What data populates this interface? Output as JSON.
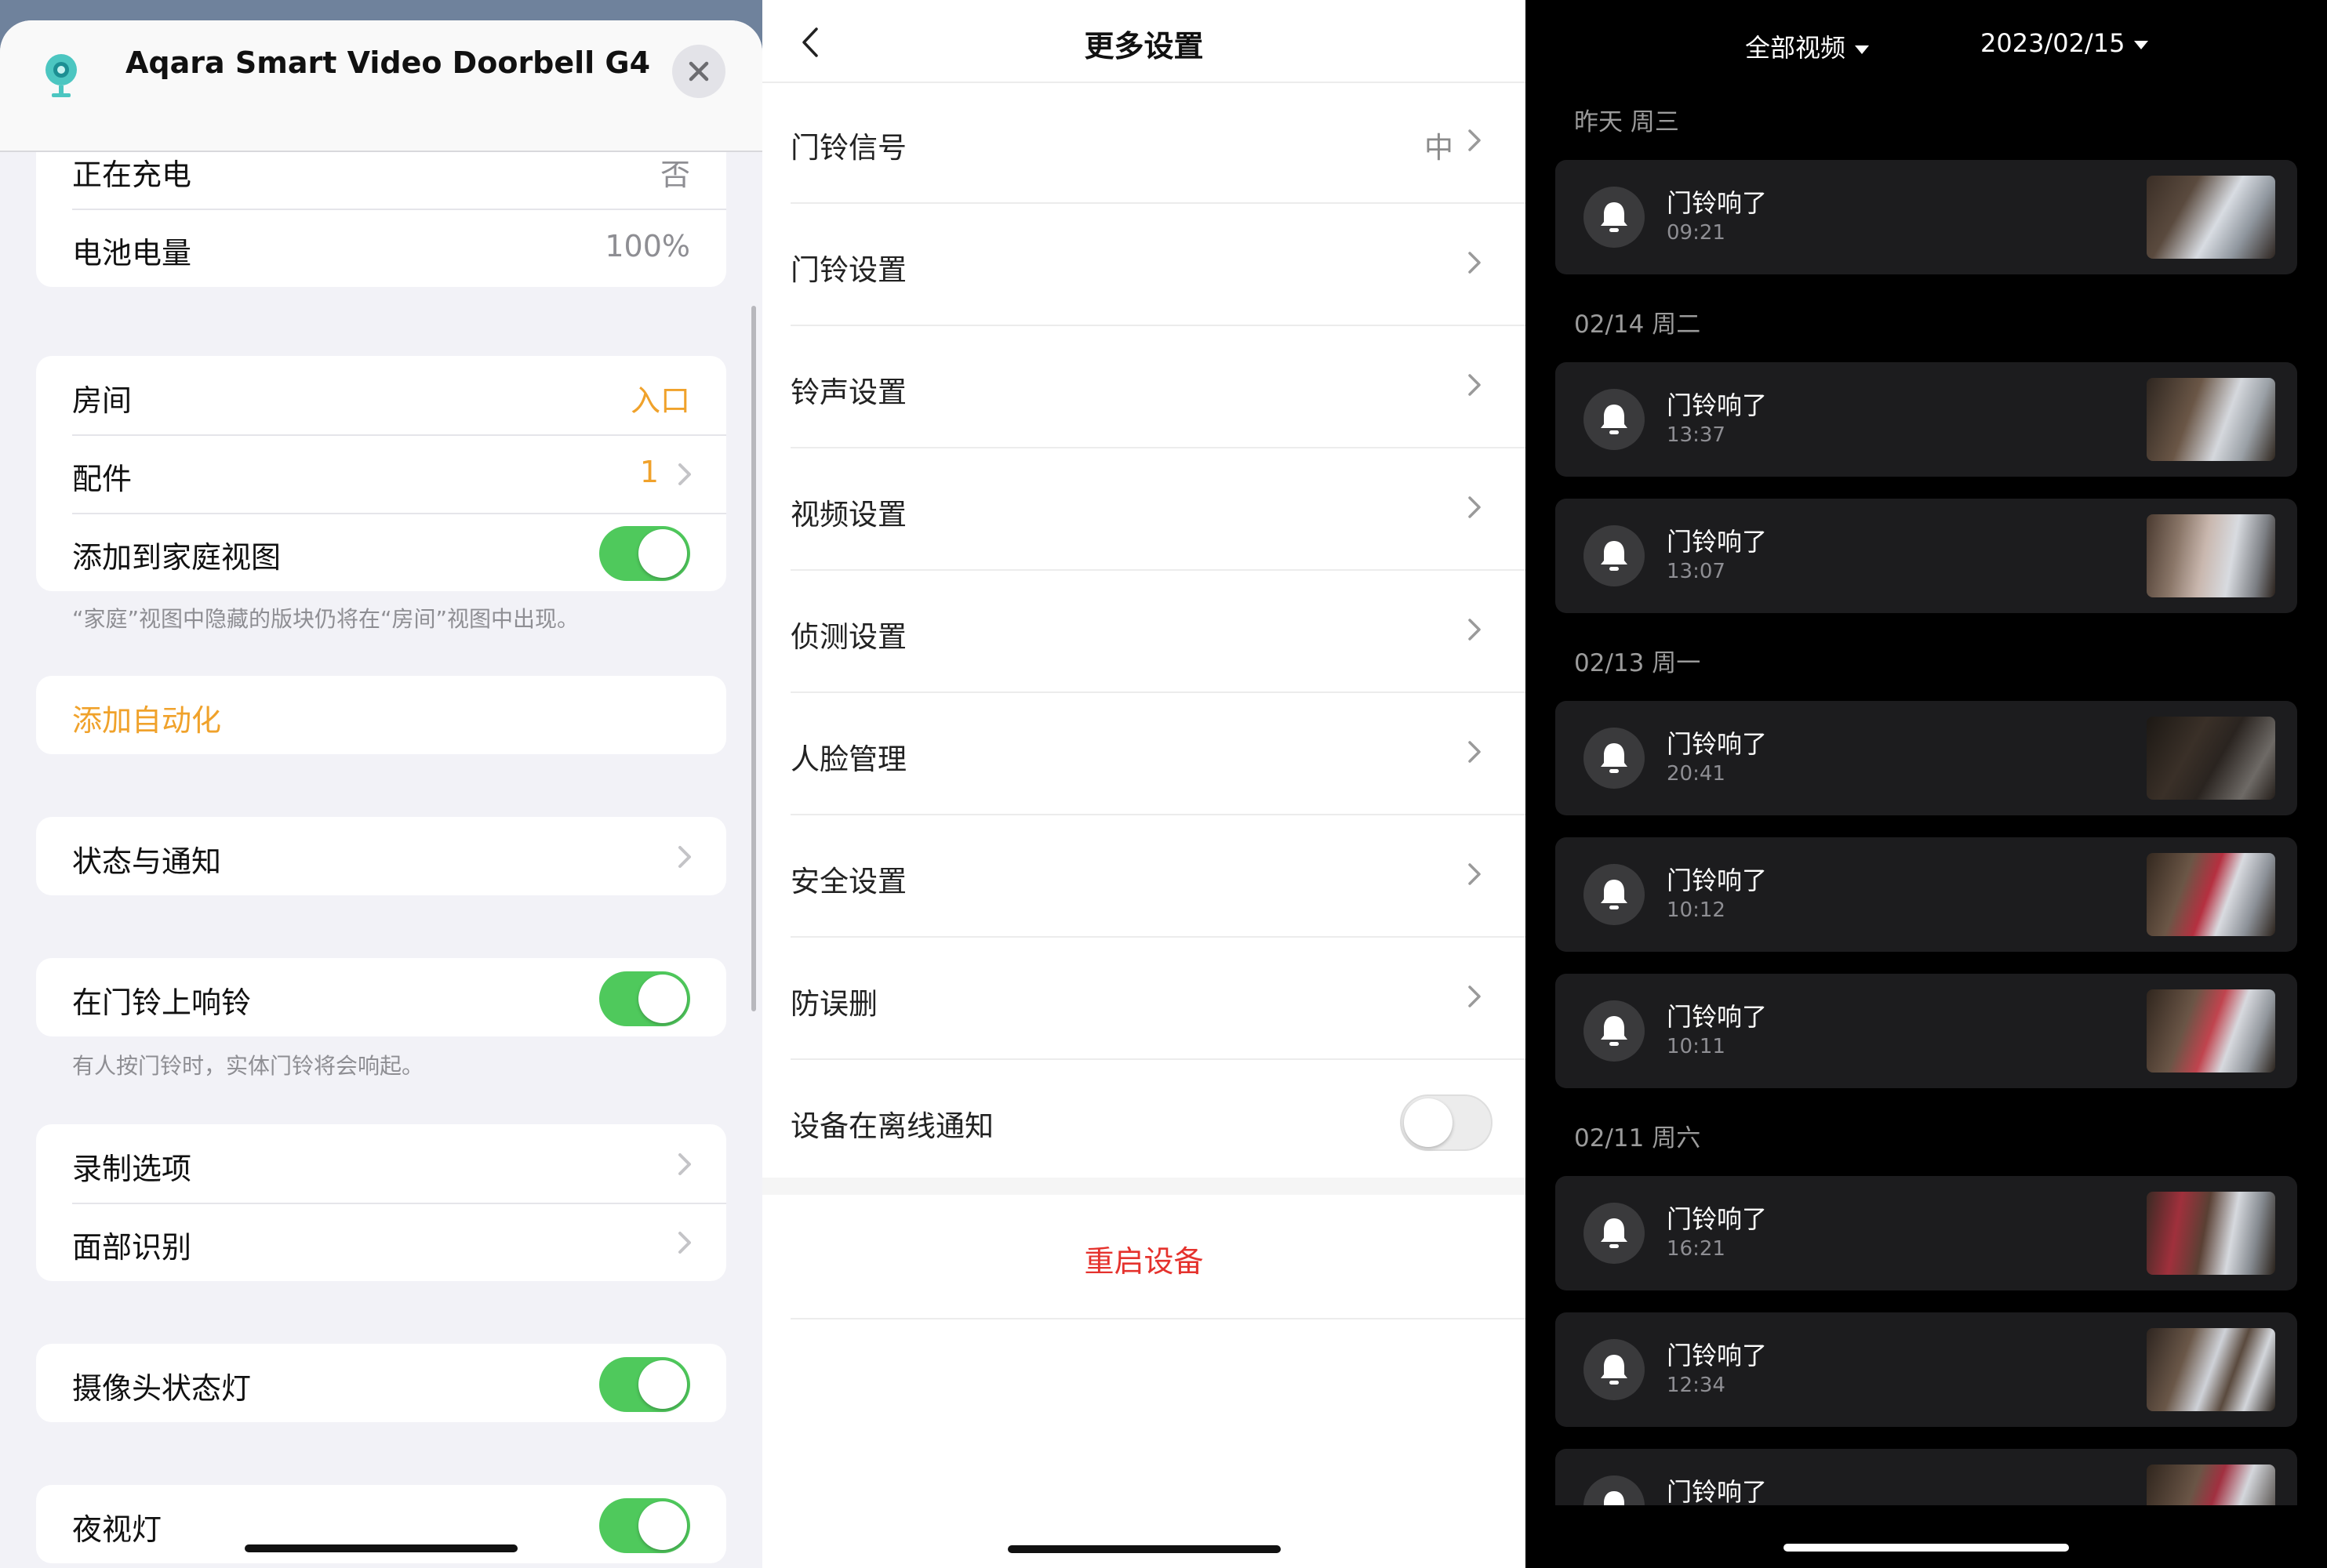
{
  "left": {
    "device_title": "Aqara Smart Video Doorbell G4",
    "rows_top": [
      {
        "label": "正在充电",
        "value": "否"
      },
      {
        "label": "电池电量",
        "value": "100%"
      }
    ],
    "room_group": {
      "room_label": "房间",
      "room_value": "入口",
      "accessory_label": "配件",
      "accessory_value": "1",
      "add_home_label": "添加到家庭视图",
      "add_home_on": true
    },
    "home_note": "“家庭”视图中隐藏的版块仍将在“房间”视图中出现。",
    "add_automation": "添加自动化",
    "status_notify": "状态与通知",
    "chime": {
      "label": "在门铃上响铃",
      "on": true
    },
    "chime_note": "有人按门铃时，实体门铃将会响起。",
    "recording": "录制选项",
    "face": "面部识别",
    "camera_light": {
      "label": "摄像头状态灯",
      "on": true
    },
    "night_light": {
      "label": "夜视灯",
      "on": true
    },
    "colors": {
      "accent": "#f0a22b",
      "toggle_on": "#4fc95c",
      "background": "#f2f2f7"
    }
  },
  "middle": {
    "title": "更多设置",
    "rows": [
      {
        "label": "门铃信号",
        "value": "中"
      },
      {
        "label": "门铃设置",
        "value": ""
      },
      {
        "label": "铃声设置",
        "value": ""
      },
      {
        "label": "视频设置",
        "value": ""
      },
      {
        "label": "侦测设置",
        "value": ""
      },
      {
        "label": "人脸管理",
        "value": ""
      },
      {
        "label": "安全设置",
        "value": ""
      },
      {
        "label": "防误删",
        "value": ""
      }
    ],
    "offline_label": "设备在离线通知",
    "offline_on": false,
    "restart": "重启设备",
    "colors": {
      "danger": "#e5322d"
    }
  },
  "right": {
    "filter_type": "全部视频",
    "filter_date": "2023/02/15",
    "groups": [
      {
        "day": "昨天 周三",
        "events": [
          {
            "title": "门铃响了",
            "time": "09:21"
          }
        ]
      },
      {
        "day": "02/14 周二",
        "events": [
          {
            "title": "门铃响了",
            "time": "13:37"
          },
          {
            "title": "门铃响了",
            "time": "13:07"
          }
        ]
      },
      {
        "day": "02/13 周一",
        "events": [
          {
            "title": "门铃响了",
            "time": "20:41"
          },
          {
            "title": "门铃响了",
            "time": "10:12"
          },
          {
            "title": "门铃响了",
            "time": "10:11"
          }
        ]
      },
      {
        "day": "02/11 周六",
        "events": [
          {
            "title": "门铃响了",
            "time": "16:21"
          },
          {
            "title": "门铃响了",
            "time": "12:34"
          },
          {
            "title": "门铃响了",
            "time": ""
          }
        ]
      }
    ]
  }
}
